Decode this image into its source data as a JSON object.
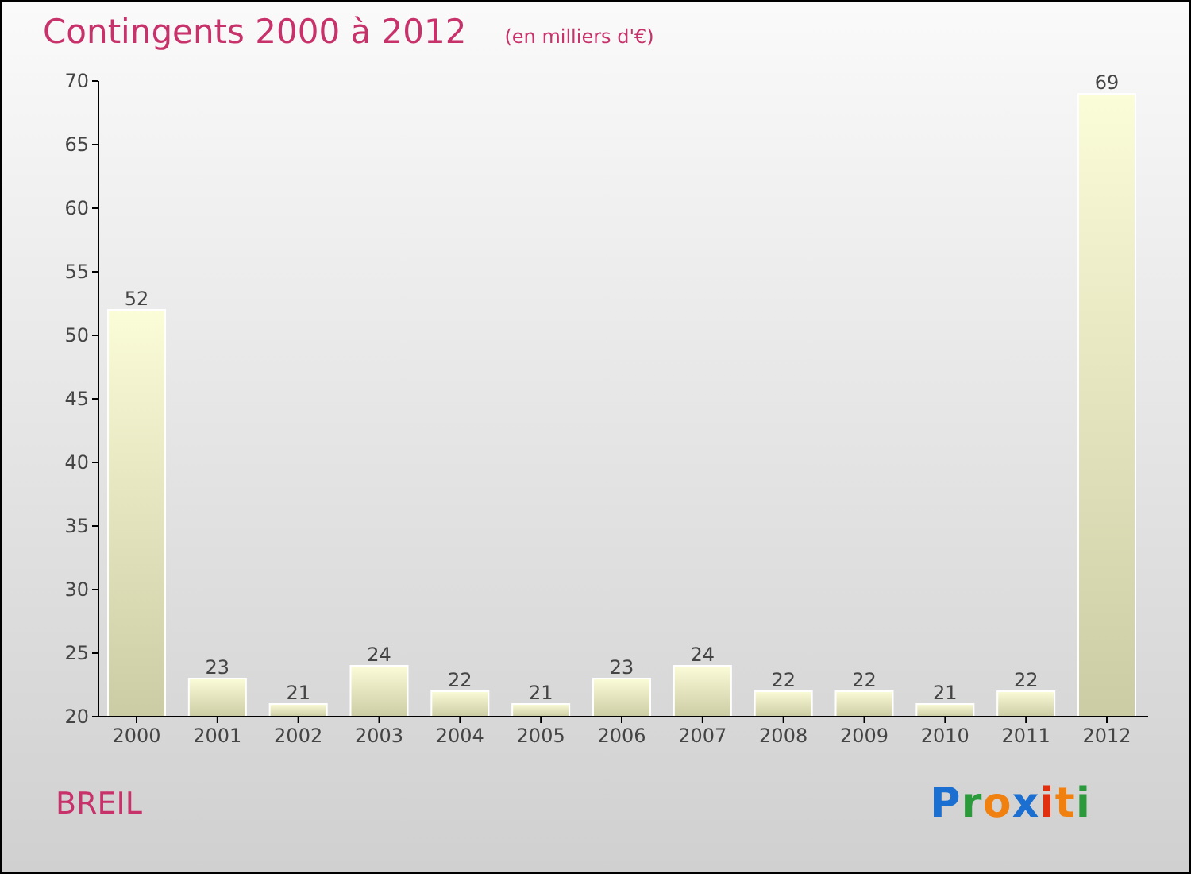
{
  "title": "Contingents 2000 à 2012",
  "subtitle": "(en milliers d'€)",
  "chart_data": {
    "type": "bar",
    "categories": [
      "2000",
      "2001",
      "2002",
      "2003",
      "2004",
      "2005",
      "2006",
      "2007",
      "2008",
      "2009",
      "2010",
      "2011",
      "2012"
    ],
    "values": [
      52,
      23,
      21,
      24,
      22,
      21,
      23,
      24,
      22,
      22,
      21,
      22,
      69
    ],
    "ylim": [
      20,
      70
    ],
    "yticks": [
      20,
      25,
      30,
      35,
      40,
      45,
      50,
      55,
      60,
      65,
      70
    ],
    "data_labels": true
  },
  "place": "BREIL",
  "logo": "Proxiti"
}
